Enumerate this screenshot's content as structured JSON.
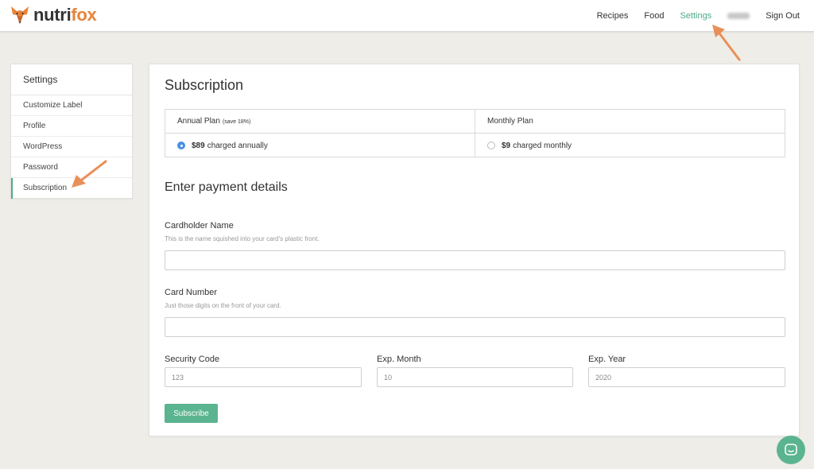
{
  "brand": {
    "name_part1": "nutri",
    "name_part2": "fox",
    "logo_icon": "fox-logo-icon",
    "accent_color": "#e8833a",
    "brand_green": "#4dab86"
  },
  "nav": {
    "items": [
      {
        "label": "Recipes",
        "active": false
      },
      {
        "label": "Food",
        "active": false
      },
      {
        "label": "Settings",
        "active": true
      }
    ],
    "sign_out": "Sign Out"
  },
  "sidebar": {
    "title": "Settings",
    "items": [
      {
        "label": "Customize Label",
        "active": false
      },
      {
        "label": "Profile",
        "active": false
      },
      {
        "label": "WordPress",
        "active": false
      },
      {
        "label": "Password",
        "active": false
      },
      {
        "label": "Subscription",
        "active": true
      }
    ]
  },
  "subscription": {
    "heading": "Subscription",
    "plans": [
      {
        "name": "Annual Plan",
        "note": "(save 18%)",
        "price": "$89",
        "desc": "charged annually",
        "selected": true
      },
      {
        "name": "Monthly Plan",
        "note": "",
        "price": "$9",
        "desc": "charged monthly",
        "selected": false
      }
    ]
  },
  "payment": {
    "heading": "Enter payment details",
    "cardholder": {
      "label": "Cardholder Name",
      "help": "This is the name squished into your card's plastic front.",
      "value": ""
    },
    "card_number": {
      "label": "Card Number",
      "help": "Just those digits on the front of your card.",
      "value": ""
    },
    "security_code": {
      "label": "Security Code",
      "placeholder": "123"
    },
    "exp_month": {
      "label": "Exp. Month",
      "placeholder": "10"
    },
    "exp_year": {
      "label": "Exp. Year",
      "placeholder": "2020"
    },
    "submit_label": "Subscribe"
  },
  "annotation_color": "#e8905a",
  "chat_icon": "chat-bubble-icon"
}
